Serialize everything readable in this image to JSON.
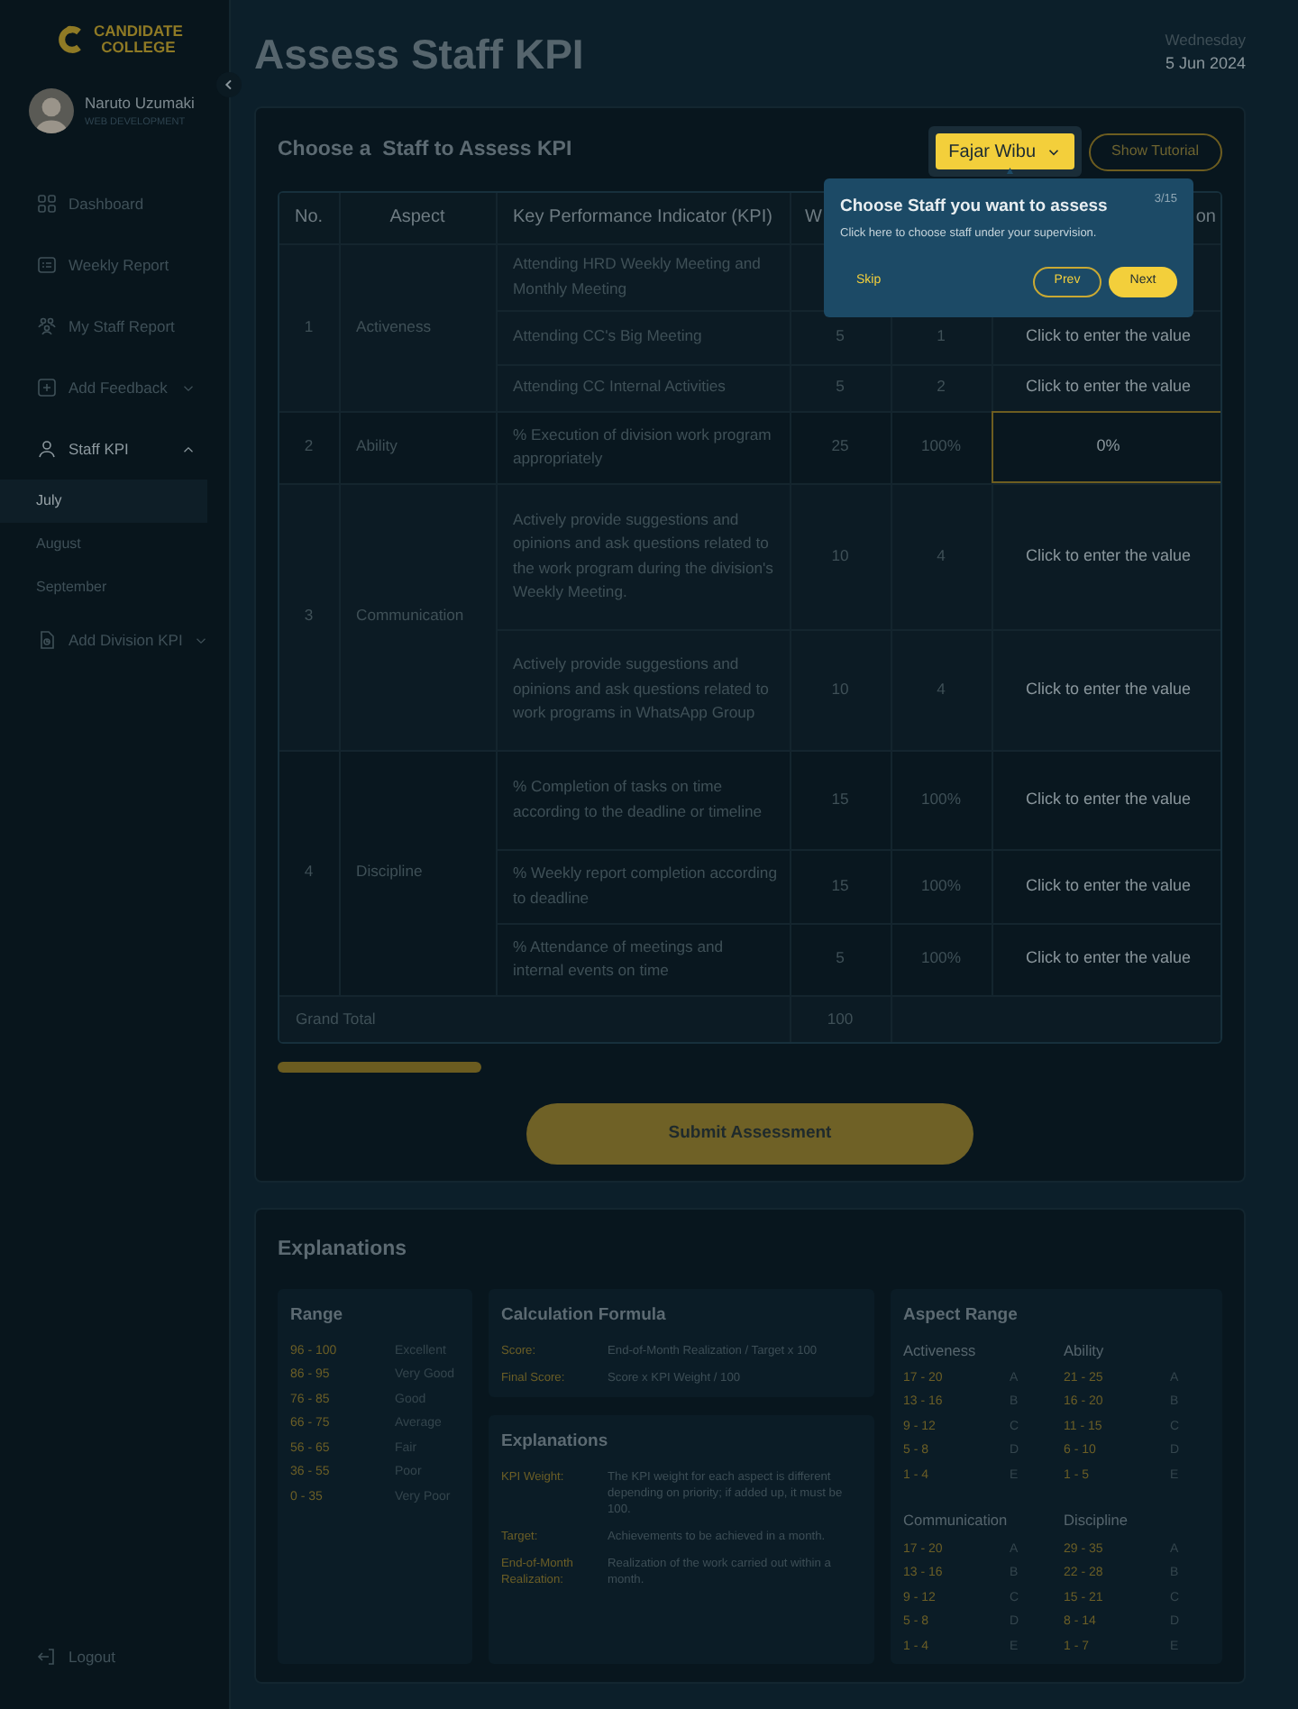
{
  "sidebar": {
    "logo": [
      "CANDIDATE",
      "COLLEGE"
    ],
    "user": {
      "name": "Naruto Uzumaki",
      "role": "WEB DEVELOPMENT"
    },
    "items": [
      {
        "label": "Dashboard",
        "kind": "link",
        "selected": false
      },
      {
        "label": "Weekly Report",
        "kind": "link",
        "selected": false
      },
      {
        "label": "My Staff Report",
        "kind": "link",
        "selected": false
      },
      {
        "label": "Add Feedback",
        "kind": "group",
        "selected": false,
        "expanded": false
      },
      {
        "label": "Staff KPI",
        "kind": "group",
        "selected": true,
        "expanded": true,
        "children": [
          {
            "label": "July",
            "selected": true
          },
          {
            "label": "August",
            "selected": false
          },
          {
            "label": "September",
            "selected": false
          }
        ]
      },
      {
        "label": "Add Division KPI",
        "kind": "group",
        "selected": false,
        "expanded": false
      }
    ],
    "logout": "Logout"
  },
  "page": {
    "title": "Assess Staff KPI",
    "day": "Wednesday",
    "date": "5 Jun 2024"
  },
  "assessment": {
    "heading": "Choose a  Staff to Assess KPI",
    "staff": "Fajar Wibu",
    "tutorial_button": "Show Tutorial",
    "columns": [
      {
        "label": "No."
      },
      {
        "label": "Aspect"
      },
      {
        "label": "Key Performance Indicator (KPI)"
      },
      {
        "label": "W"
      },
      {},
      {
        "label": "on"
      }
    ],
    "aspects": [
      {
        "no": "1",
        "name": "Activeness",
        "kpis": [
          {
            "indicator": "Attending HRD Weekly Meeting and Monthly Meeting"
          },
          {
            "indicator": "Attending CC's Big Meeting",
            "weight": "5",
            "target": "1",
            "value": "Click to enter the value",
            "selected": false
          },
          {
            "indicator": "Attending CC Internal Activities",
            "weight": "5",
            "target": "2",
            "value": "Click to enter the value",
            "selected": false
          }
        ]
      },
      {
        "no": "2",
        "name": "Ability",
        "kpis": [
          {
            "indicator": "% Execution of division work program appropriately",
            "weight": "25",
            "target": "100%",
            "value": "0%",
            "selected": true
          }
        ]
      },
      {
        "no": "3",
        "name": "Communication",
        "kpis": [
          {
            "indicator": "Actively provide suggestions and opinions and ask questions related to the work program during the division's Weekly Meeting.",
            "weight": "10",
            "target": "4",
            "value": "Click to enter the value",
            "selected": false
          },
          {
            "indicator": "Actively provide suggestions and opinions and ask questions related to work programs in WhatsApp Group",
            "weight": "10",
            "target": "4",
            "value": "Click to enter the value",
            "selected": false
          }
        ]
      },
      {
        "no": "4",
        "name": "Discipline",
        "kpis": [
          {
            "indicator": "% Completion of tasks on time according to the deadline or timeline",
            "weight": "15",
            "target": "100%",
            "value": "Click to enter the value",
            "selected": false
          },
          {
            "indicator": "% Weekly report completion according to deadline",
            "weight": "15",
            "target": "100%",
            "value": "Click to enter the value",
            "selected": false
          },
          {
            "indicator": "% Attendance of meetings and internal events on time",
            "weight": "5",
            "target": "100%",
            "value": "Click to enter the value",
            "selected": false
          }
        ]
      }
    ],
    "grand_total": {
      "label": "Grand Total",
      "weight": "100"
    },
    "submit_button": "Submit Assessment"
  },
  "tutorial": {
    "title": "Choose Staff you want to assess",
    "step": "3/15",
    "text": "Click here to choose staff under your supervision.",
    "skip": "Skip",
    "prev": "Prev",
    "next": "Next"
  },
  "explanations": {
    "heading": "Explanations",
    "range": {
      "title": "Range",
      "rows": [
        {
          "range": "96 - 100",
          "label": "Excellent"
        },
        {
          "range": "86 - 95",
          "label": "Very Good"
        },
        {
          "range": "76 - 85",
          "label": "Good"
        },
        {
          "range": "66 - 75",
          "label": "Average"
        },
        {
          "range": "56 - 65",
          "label": "Fair"
        },
        {
          "range": "36 - 55",
          "label": "Poor"
        },
        {
          "range": "0 - 35",
          "label": "Very Poor"
        }
      ]
    },
    "formula": {
      "title": "Calculation Formula",
      "rows": [
        {
          "term": "Score:",
          "text": "End-of-Month Realization / Target x 100"
        },
        {
          "term": "Final Score:",
          "text": "Score x KPI Weight / 100"
        }
      ]
    },
    "terms": {
      "title": "Explanations",
      "rows": [
        {
          "term": "KPI Weight:",
          "text": "The KPI weight for each aspect is different depending on priority; if added up, it must be 100."
        },
        {
          "term": "Target:",
          "text": "Achievements to be achieved in a month."
        },
        {
          "term": "End-of-Month Realization:",
          "text": "Realization of the work carried out within a month."
        }
      ]
    },
    "aspect_range": {
      "title": "Aspect Range",
      "groups": [
        {
          "name": "Activeness",
          "rows": [
            {
              "range": "17 - 20",
              "grade": "A"
            },
            {
              "range": "13 - 16",
              "grade": "B"
            },
            {
              "range": "9 - 12",
              "grade": "C"
            },
            {
              "range": "5 - 8",
              "grade": "D"
            },
            {
              "range": "1 - 4",
              "grade": "E"
            }
          ]
        },
        {
          "name": "Ability",
          "rows": [
            {
              "range": "21 - 25",
              "grade": "A"
            },
            {
              "range": "16 - 20",
              "grade": "B"
            },
            {
              "range": "11 - 15",
              "grade": "C"
            },
            {
              "range": "6 - 10",
              "grade": "D"
            },
            {
              "range": "1 - 5",
              "grade": "E"
            }
          ]
        },
        {
          "name": "Communication",
          "rows": [
            {
              "range": "17 - 20",
              "grade": "A"
            },
            {
              "range": "13 - 16",
              "grade": "B"
            },
            {
              "range": "9 - 12",
              "grade": "C"
            },
            {
              "range": "5 - 8",
              "grade": "D"
            },
            {
              "range": "1 - 4",
              "grade": "E"
            }
          ]
        },
        {
          "name": "Discipline",
          "rows": [
            {
              "range": "29 - 35",
              "grade": "A"
            },
            {
              "range": "22 - 28",
              "grade": "B"
            },
            {
              "range": "15 - 21",
              "grade": "C"
            },
            {
              "range": "8 - 14",
              "grade": "D"
            },
            {
              "range": "1 - 7",
              "grade": "E"
            }
          ]
        }
      ]
    }
  }
}
